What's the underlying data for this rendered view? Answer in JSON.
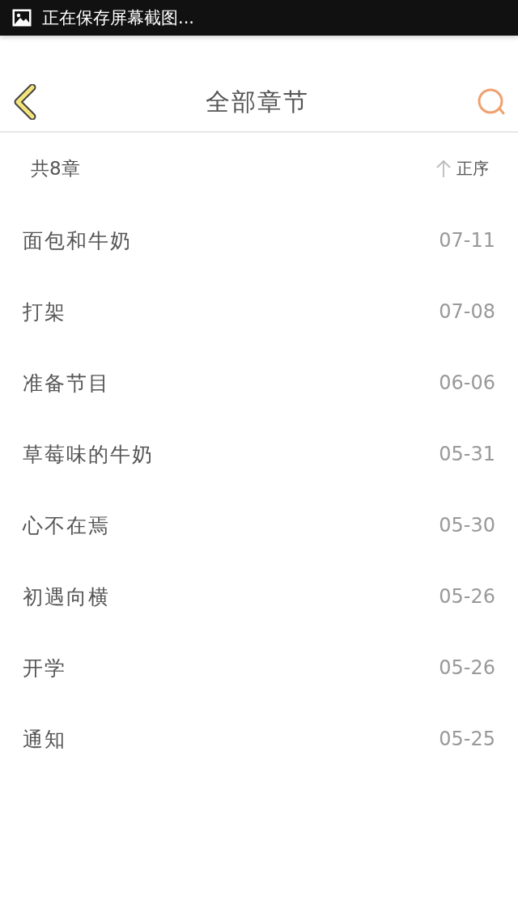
{
  "status_bar": {
    "notification": "正在保存屏幕截图..."
  },
  "header": {
    "title": "全部章节"
  },
  "summary": {
    "count": "共8章",
    "sort": "正序"
  },
  "chapters": [
    {
      "title": "面包和牛奶",
      "date": "07-11"
    },
    {
      "title": "打架",
      "date": "07-08"
    },
    {
      "title": "准备节目",
      "date": "06-06"
    },
    {
      "title": "草莓味的牛奶",
      "date": "05-31"
    },
    {
      "title": "心不在焉",
      "date": "05-30"
    },
    {
      "title": "初遇向横",
      "date": "05-26"
    },
    {
      "title": "开学",
      "date": "05-26"
    },
    {
      "title": "通知",
      "date": "05-25"
    }
  ]
}
